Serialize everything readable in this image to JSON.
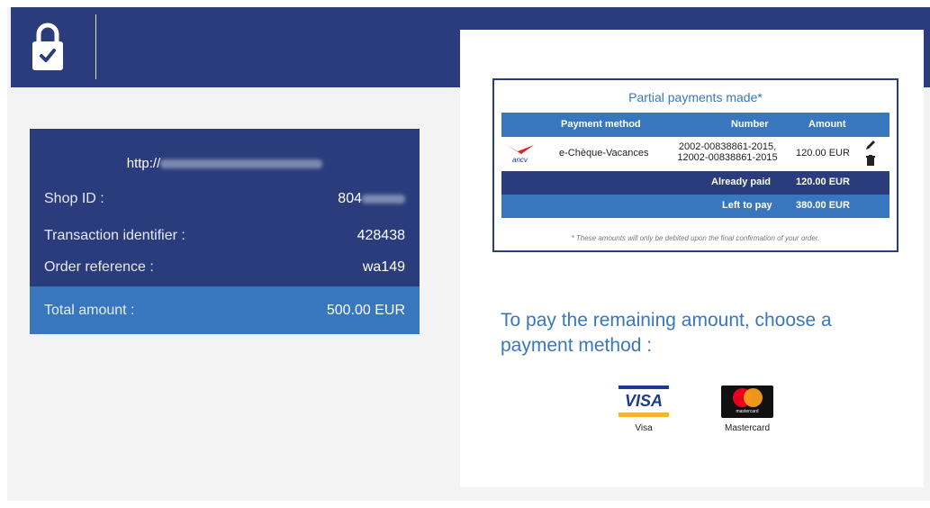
{
  "header": {
    "icon": "lock-check-icon"
  },
  "summary": {
    "url_prefix": "http://",
    "shop_id_label": "Shop ID :",
    "shop_id_value": "804",
    "transaction_label": "Transaction identifier :",
    "transaction_value": "428438",
    "order_label": "Order reference :",
    "order_value": "wa149",
    "total_label": "Total amount :",
    "total_value": "500.00 EUR"
  },
  "partial_payments": {
    "title": "Partial payments made*",
    "columns": [
      "Payment method",
      "Number",
      "Amount"
    ],
    "rows": [
      {
        "logo_text": "ancv",
        "method": "e-Chèque-Vacances",
        "number_line1": "2002-00838861-2015,",
        "number_line2": "12002-00838861-2015",
        "amount": "120.00 EUR"
      }
    ],
    "already_paid_label": "Already paid",
    "already_paid_value": "120.00 EUR",
    "left_to_pay_label": "Left to pay",
    "left_to_pay_value": "380.00 EUR",
    "footnote": "* These amounts will only be debited upon the final confirmation of your order."
  },
  "choose": {
    "text": "To pay the remaining amount, choose a payment method :"
  },
  "methods": {
    "visa_logo": "VISA",
    "visa_label": "Visa",
    "mastercard_logo": "mastercard",
    "mastercard_label": "Mastercard"
  },
  "colors": {
    "navy": "#2a3c7b",
    "blue": "#3877bd",
    "background": "#f3f3f4"
  }
}
